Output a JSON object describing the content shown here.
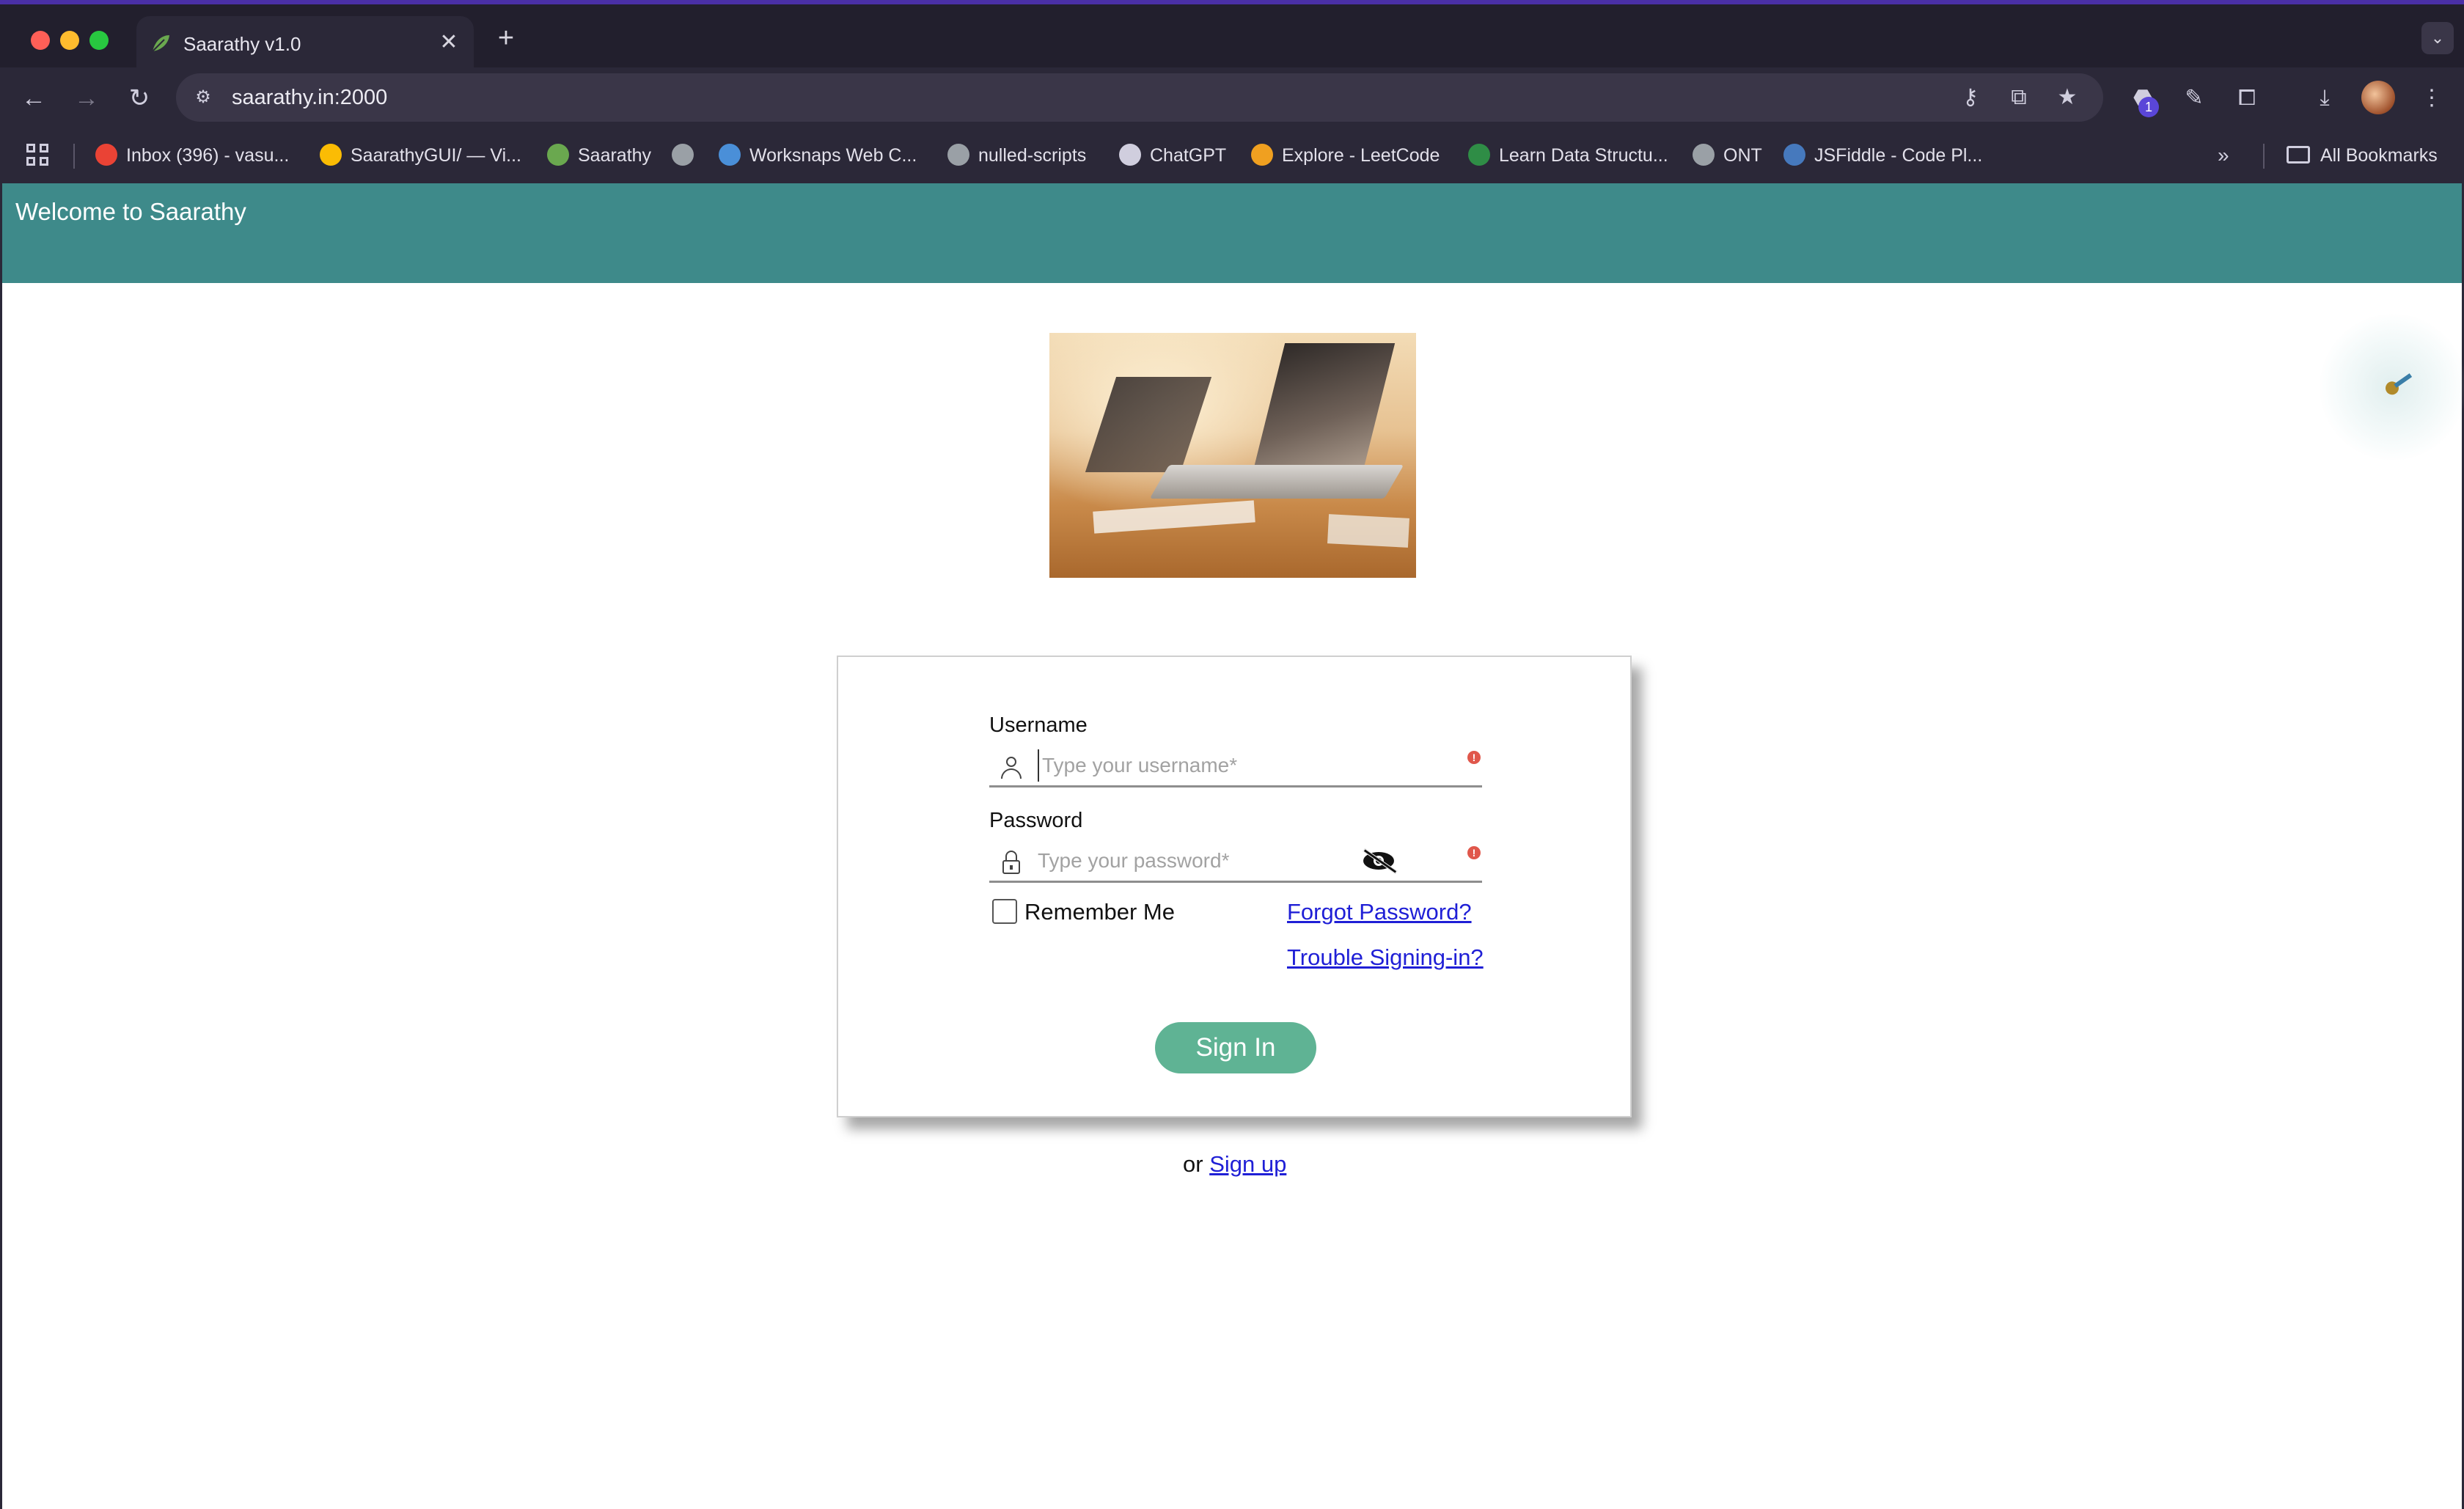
{
  "browser": {
    "tab": {
      "title": "Saarathy v1.0",
      "close_glyph": "✕",
      "favicon": "leaf-icon"
    },
    "new_tab_glyph": "+",
    "tab_search_glyph": "⌄",
    "url": "saarathy.in:2000",
    "extension_badge_count": "1",
    "bookmarks": [
      {
        "label": "Inbox (396) - vasu...",
        "icon": "gmail-icon",
        "color": "#ea4335"
      },
      {
        "label": "SaarathyGUI/ — Vi...",
        "icon": "chrome-icon",
        "color": "#fbbc04"
      },
      {
        "label": "Saarathy",
        "icon": "leaf-icon",
        "color": "#6aa84f"
      },
      {
        "label": "",
        "icon": "globe-icon",
        "color": "#9aa0a6"
      },
      {
        "label": "Worksnaps Web C...",
        "icon": "worksnaps-icon",
        "color": "#4a8fd8"
      },
      {
        "label": "nulled-scripts",
        "icon": "globe-icon",
        "color": "#9aa0a6"
      },
      {
        "label": "ChatGPT",
        "icon": "openai-icon",
        "color": "#d0cede"
      },
      {
        "label": "Explore - LeetCode",
        "icon": "leetcode-icon",
        "color": "#f0a020"
      },
      {
        "label": "Learn Data Structu...",
        "icon": "gfg-icon",
        "color": "#2f8d46"
      },
      {
        "label": "ONT",
        "icon": "globe-icon",
        "color": "#9aa0a6"
      },
      {
        "label": "JSFiddle - Code Pl...",
        "icon": "jsfiddle-icon",
        "color": "#4679bd"
      }
    ],
    "more_glyph": "»",
    "all_bookmarks": "All Bookmarks"
  },
  "page": {
    "header": {
      "welcome": "Welcome to Saarathy",
      "band_color": "#3e8a8a"
    },
    "login": {
      "username_label": "Username",
      "username_placeholder": "Type your username*",
      "password_label": "Password",
      "password_placeholder": "Type your password*",
      "remember_label": "Remember Me",
      "remember_checked": false,
      "forgot_link": "Forgot Password?",
      "trouble_link": "Trouble Signing-in?",
      "signin_button": "Sign In",
      "error_glyph": "!"
    },
    "signup": {
      "prefix": "or ",
      "link": "Sign up"
    }
  }
}
